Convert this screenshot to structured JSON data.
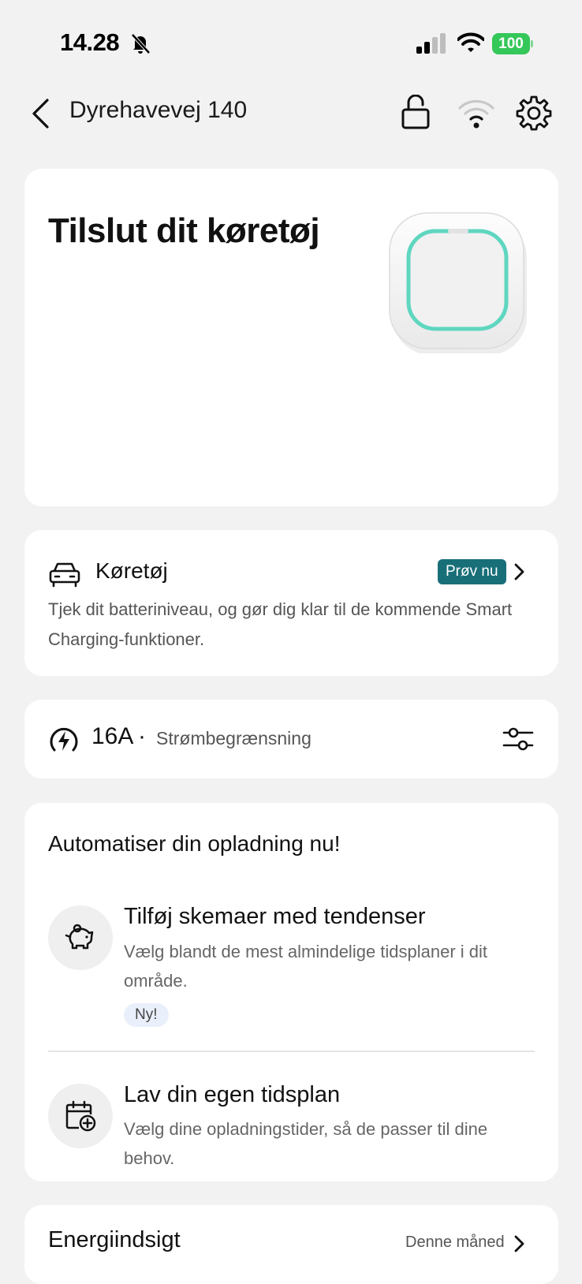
{
  "status_bar": {
    "time": "14.28",
    "battery": "100",
    "battery_color": "#34c759"
  },
  "header": {
    "title": "Dyrehavevej 140",
    "icons": [
      "back-icon",
      "lock-icon",
      "wifi-icon",
      "gear-icon"
    ]
  },
  "hero": {
    "title": "Tilslut dit køretøj",
    "ring_color": "#5fd6c0"
  },
  "vehicle": {
    "title": "Køretøj",
    "badge": "Prøv nu",
    "badge_color": "#186f78",
    "description": "Tjek dit batteriniveau, og gør dig klar til de kommende Smart Charging-funktioner."
  },
  "current_limit": {
    "value": "16A",
    "separator": "·",
    "label": "Strømbegrænsning"
  },
  "automate": {
    "title": "Automatiser din opladning nu!",
    "options": [
      {
        "title": "Tilføj skemaer med tendenser",
        "description": "Vælg blandt de mest almindelige tidsplaner i dit område.",
        "badge": "Ny!",
        "icon": "piggy-bank-icon"
      },
      {
        "title": "Lav din egen tidsplan",
        "description": "Vælg dine opladningstider, så de passer til dine behov.",
        "icon": "calendar-add-icon"
      }
    ]
  },
  "energy": {
    "title": "Energiindsigt",
    "period": "Denne måned"
  }
}
